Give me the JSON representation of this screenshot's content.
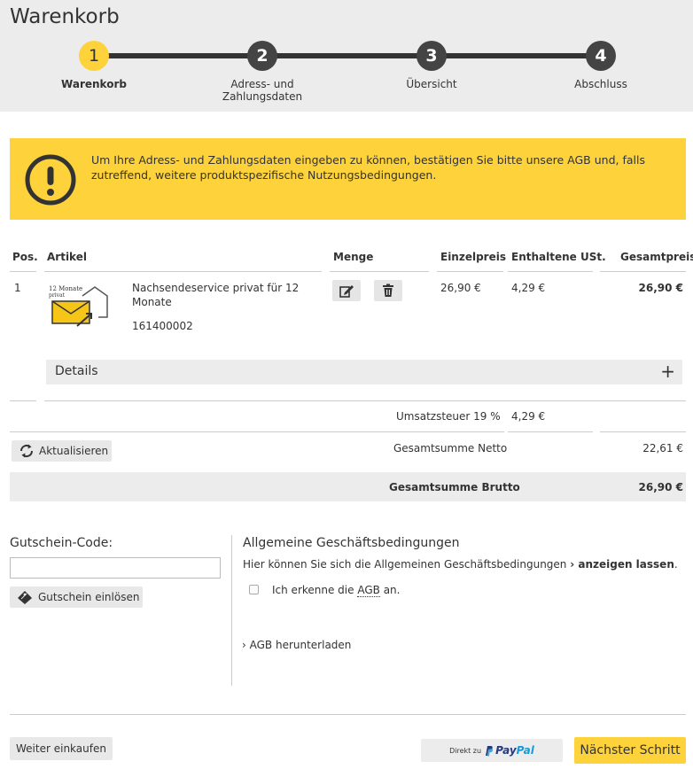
{
  "page": {
    "title": "Warenkorb"
  },
  "steps": [
    {
      "num": "1",
      "label": "Warenkorb"
    },
    {
      "num": "2",
      "label": "Adress- und Zahlungsdaten"
    },
    {
      "num": "3",
      "label": "Übersicht"
    },
    {
      "num": "4",
      "label": "Abschluss"
    }
  ],
  "notice": {
    "text": "Um Ihre Adress- und Zahlungsdaten eingeben zu können, bestätigen Sie bitte unsere AGB und, falls zutreffend, weitere produktspezifische Nutzungsbedingungen."
  },
  "table": {
    "headers": {
      "pos": "Pos.",
      "article": "Artikel",
      "qty": "Menge",
      "unit_price": "Einzelpreis",
      "vat": "Enthaltene USt.",
      "total": "Gesamtpreis"
    },
    "rows": [
      {
        "pos": "1",
        "image_lines": [
          "12 Monate",
          "privat"
        ],
        "name": "Nachsendeservice privat für 12 Monate",
        "article_no": "161400002",
        "unit_price": "26,90 €",
        "vat": "4,29 €",
        "total": "26,90 €"
      }
    ],
    "details_label": "Details",
    "details_toggle": "+"
  },
  "summary": {
    "vat_label": "Umsatzsteuer 19 %",
    "vat_value": "4,29 €",
    "net_label": "Gesamtsumme Netto",
    "net_value": "22,61 €",
    "gross_label": "Gesamtsumme Brutto",
    "gross_value": "26,90 €",
    "update_button": "Aktualisieren"
  },
  "voucher": {
    "label": "Gutschein-Code:",
    "value": "",
    "button": "Gutschein einlösen"
  },
  "agb": {
    "title": "Allgemeine Geschäftsbedingungen",
    "text_before": "Hier können Sie sich die Allgemeinen Geschäftsbedingungen ",
    "link": "› anzeigen lassen",
    "text_after": ".",
    "checkbox_before": "Ich erkenne die ",
    "checkbox_abbr": "AGB",
    "checkbox_after": " an.",
    "download": "› AGB herunterladen"
  },
  "footer": {
    "continue_shopping": "Weiter einkaufen",
    "paypal_prefix": "Direkt zu",
    "paypal_brand_1": "Pay",
    "paypal_brand_2": "Pal",
    "next_step": "Nächster Schritt"
  },
  "colors": {
    "accent": "#fdd23a",
    "dark": "#444444",
    "panel": "#ececec"
  }
}
